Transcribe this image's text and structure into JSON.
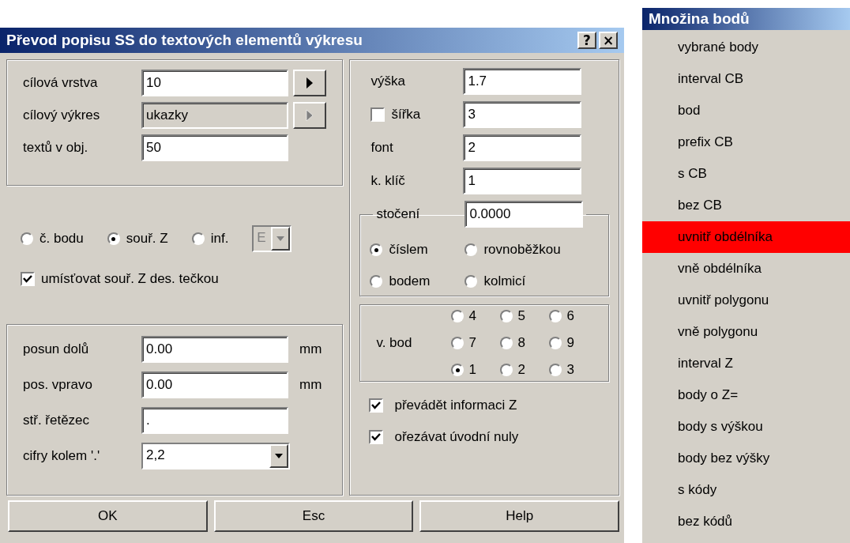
{
  "window": {
    "title": "Převod popisu SS do textových elementů výkresu",
    "controls": [
      "?",
      "×"
    ]
  },
  "target": [
    {
      "label": "cílová vrstva",
      "value": "10",
      "kind": "browse",
      "disabled": false
    },
    {
      "label": "cílový výkres",
      "value": "ukazky",
      "kind": "browse",
      "disabled": true
    },
    {
      "label": "textů v obj.",
      "value": "50",
      "kind": "plain",
      "disabled": false
    }
  ],
  "source": {
    "options": [
      {
        "label": "č. bodu",
        "selected": false
      },
      {
        "label": "souř. Z",
        "selected": true
      },
      {
        "label": "inf.",
        "selected": false
      }
    ],
    "info_select": {
      "value": "E",
      "disabled": true
    }
  },
  "place_with_dot": {
    "label": "umísťovat souř. Z des. tečkou",
    "checked": true
  },
  "offsets": [
    {
      "label": "posun dolů",
      "value": "0.00",
      "unit": "mm",
      "kind": "text"
    },
    {
      "label": "pos. vpravo",
      "value": "0.00",
      "unit": "mm",
      "kind": "text"
    },
    {
      "label": "stř. řetězec",
      "value": ".",
      "kind": "text"
    },
    {
      "label": "cifry kolem '.'",
      "value": "2,2",
      "kind": "select"
    }
  ],
  "text_params": [
    {
      "label": "výška",
      "value": "1.7",
      "kind": "plain"
    },
    {
      "label": "šířka",
      "value": "3",
      "kind": "check",
      "checked": false
    },
    {
      "label": "font",
      "value": "2",
      "kind": "plain"
    },
    {
      "label": "k. klíč",
      "value": "1",
      "kind": "plain"
    }
  ],
  "rotation": {
    "label": "stočení",
    "value": "0.0000",
    "options": [
      {
        "label": "číslem",
        "selected": true
      },
      {
        "label": "rovnoběžkou",
        "selected": false
      },
      {
        "label": "bodem",
        "selected": false
      },
      {
        "label": "kolmicí",
        "selected": false
      }
    ]
  },
  "anchor": {
    "label": "v. bod",
    "options": [
      {
        "label": "4",
        "selected": false
      },
      {
        "label": "5",
        "selected": false
      },
      {
        "label": "6",
        "selected": false
      },
      {
        "label": "7",
        "selected": false
      },
      {
        "label": "8",
        "selected": false
      },
      {
        "label": "9",
        "selected": false
      },
      {
        "label": "1",
        "selected": true
      },
      {
        "label": "2",
        "selected": false
      },
      {
        "label": "3",
        "selected": false
      }
    ]
  },
  "flags": [
    {
      "label": "převádět informaci Z",
      "checked": true
    },
    {
      "label": "ořezávat úvodní nuly",
      "checked": true
    }
  ],
  "buttons": [
    "OK",
    "Esc",
    "Help"
  ],
  "menu": {
    "title": "Množina bodů",
    "items": [
      {
        "label": "vybrané body",
        "selected": false
      },
      {
        "label": "interval CB",
        "selected": false
      },
      {
        "label": "bod",
        "selected": false
      },
      {
        "label": "prefix CB",
        "selected": false
      },
      {
        "label": "s CB",
        "selected": false
      },
      {
        "label": "bez CB",
        "selected": false
      },
      {
        "label": "uvnitř obdélníka",
        "selected": true
      },
      {
        "label": "vně obdélníka",
        "selected": false
      },
      {
        "label": "uvnitř polygonu",
        "selected": false
      },
      {
        "label": "vně polygonu",
        "selected": false
      },
      {
        "label": "interval Z",
        "selected": false
      },
      {
        "label": "body o Z=",
        "selected": false
      },
      {
        "label": "body s výškou",
        "selected": false
      },
      {
        "label": "body bez výšky",
        "selected": false
      },
      {
        "label": "s kódy",
        "selected": false
      },
      {
        "label": "bez kódů",
        "selected": false
      }
    ]
  }
}
